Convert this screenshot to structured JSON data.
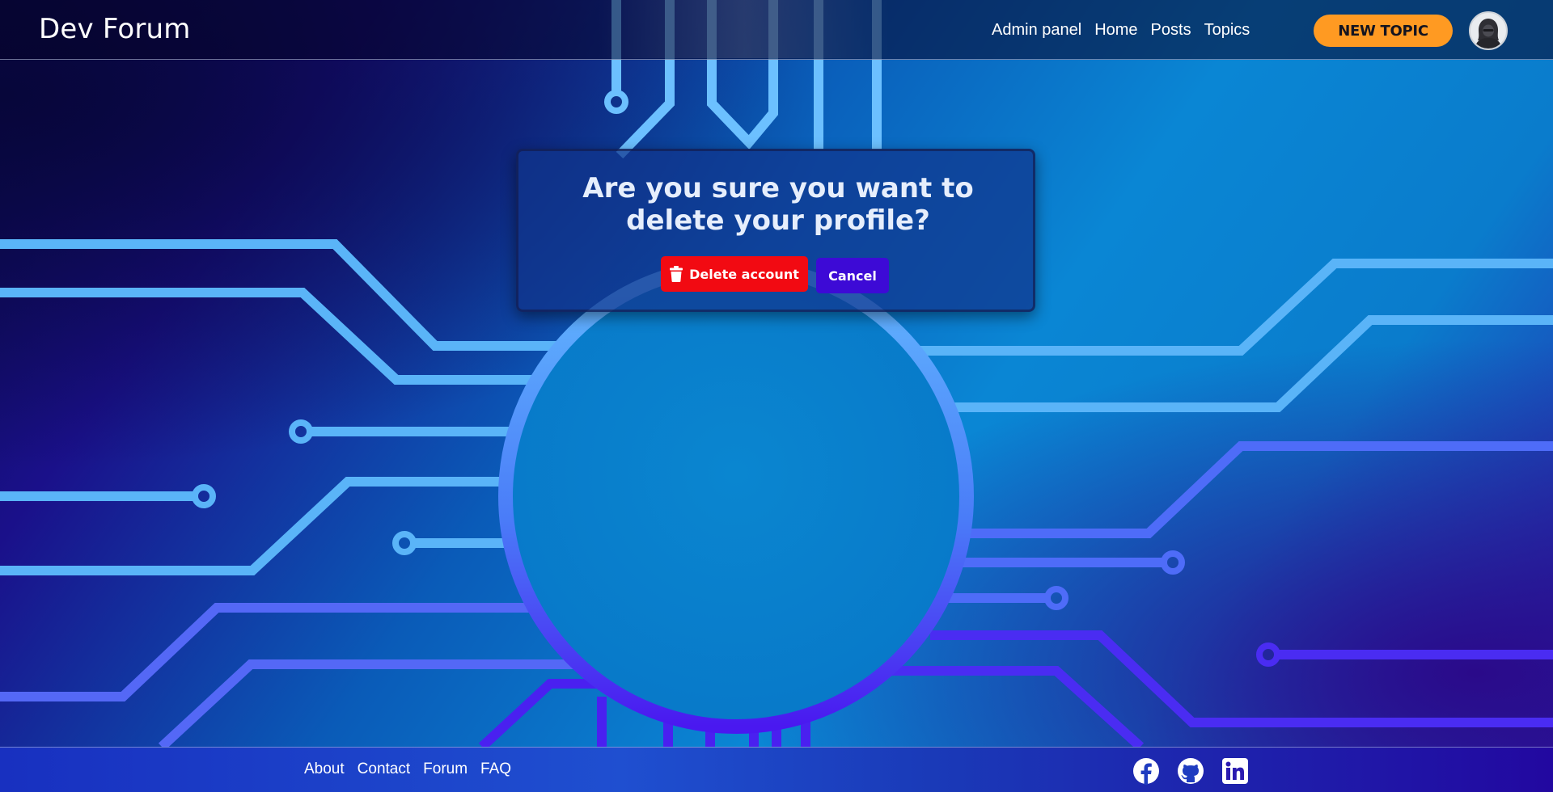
{
  "header": {
    "brand": "Dev Forum",
    "nav": [
      "Admin panel",
      "Home",
      "Posts",
      "Topics"
    ],
    "new_topic_label": "NEW TOPIC",
    "avatar_icon": "hooded-user-avatar-icon"
  },
  "dialog": {
    "title": "Are you sure you want to delete your profile?",
    "delete_label": "Delete account",
    "delete_icon": "trash-icon",
    "cancel_label": "Cancel"
  },
  "footer": {
    "links": [
      "About",
      "Contact",
      "Forum",
      "FAQ"
    ],
    "social_icons": [
      "facebook-icon",
      "github-icon",
      "linkedin-icon"
    ]
  },
  "colors": {
    "accent_orange": "#ff9a22",
    "danger_red": "#f20a12",
    "cancel_purple": "#3d0ad6",
    "circuit_light_blue": "#5ab4f8",
    "circuit_violet": "#4a2cf2"
  }
}
